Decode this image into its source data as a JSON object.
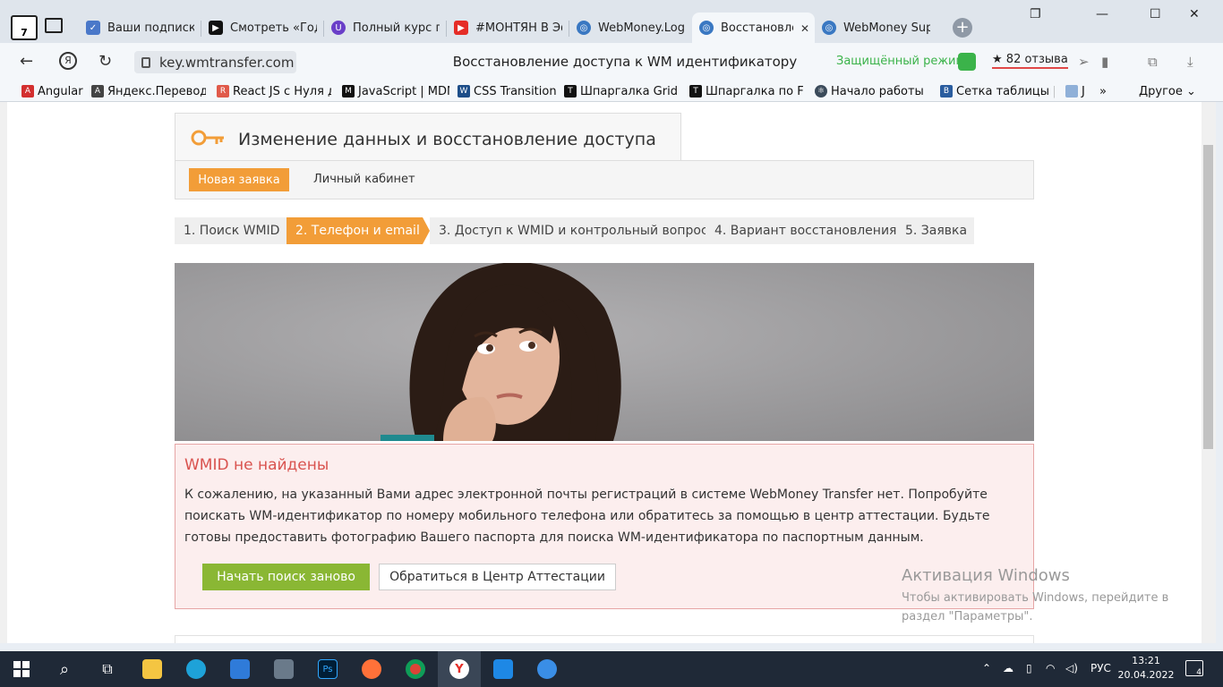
{
  "browser": {
    "home_badge": "7",
    "tabs": [
      {
        "label": "Ваши подписки",
        "icon": "check-favicon"
      },
      {
        "label": "Смотреть «Год",
        "icon": "play-favicon"
      },
      {
        "label": "Полный курс п",
        "icon": "u-favicon"
      },
      {
        "label": "#МОНТЯН В Эф",
        "icon": "youtube-favicon"
      },
      {
        "label": "WebMoney.Log",
        "icon": "webmoney-favicon"
      },
      {
        "label": "Восстановле",
        "icon": "webmoney-favicon"
      },
      {
        "label": "WebMoney Sup",
        "icon": "webmoney-favicon"
      }
    ],
    "url": "key.wmtransfer.com",
    "page_title": "Восстановление доступа к WM идентификатору",
    "secure_mode": "Защищённый режим",
    "reviews": "82 отзыва",
    "bookmarks": [
      "Angular",
      "Яндекс.Переводч",
      "React JS с Нуля до",
      "JavaScript | MDN",
      "CSS Transitions",
      "Шпаргалка Grid C",
      "Шпаргалка по Fle",
      "Начало работы –",
      "Сетка таблицы | h",
      "J"
    ],
    "other_bookmarks": "Другое"
  },
  "header": {
    "title": "Изменение данных и восстановление доступа",
    "new_request": "Новая заявка",
    "cabinet": "Личный кабинет"
  },
  "steps": [
    "1. Поиск WMID",
    "2. Телефон и email",
    "3. Доступ к WMID и контрольный вопрос",
    "4. Вариант восстановления",
    "5. Заявка"
  ],
  "active_step": 2,
  "alert": {
    "title": "WMID не найдены",
    "text": "К сожалению, на указанный Вами адрес электронной почты регистраций в системе WebMoney Transfer нет. Попробуйте поискать WM-идентификатор по номеру мобильного телефона или обратитесь за помощью в центр аттестации. Будьте готовы предоставить фотографию Вашего паспорта для поиска WM-идентификатора по паспортным данным.",
    "restart_button": "Начать поиск заново",
    "attestation_button": "Обратиться в Центр Аттестации"
  },
  "watermark": {
    "title": "Активация Windows",
    "text": "Чтобы активировать Windows, перейдите в раздел \"Параметры\"."
  },
  "taskbar": {
    "lang": "РУС",
    "time": "13:21",
    "date": "20.04.2022",
    "notifications": "4"
  },
  "colors": {
    "accent_orange": "#f29d38",
    "green_button": "#8ab734",
    "alert_red": "#d9534f"
  }
}
